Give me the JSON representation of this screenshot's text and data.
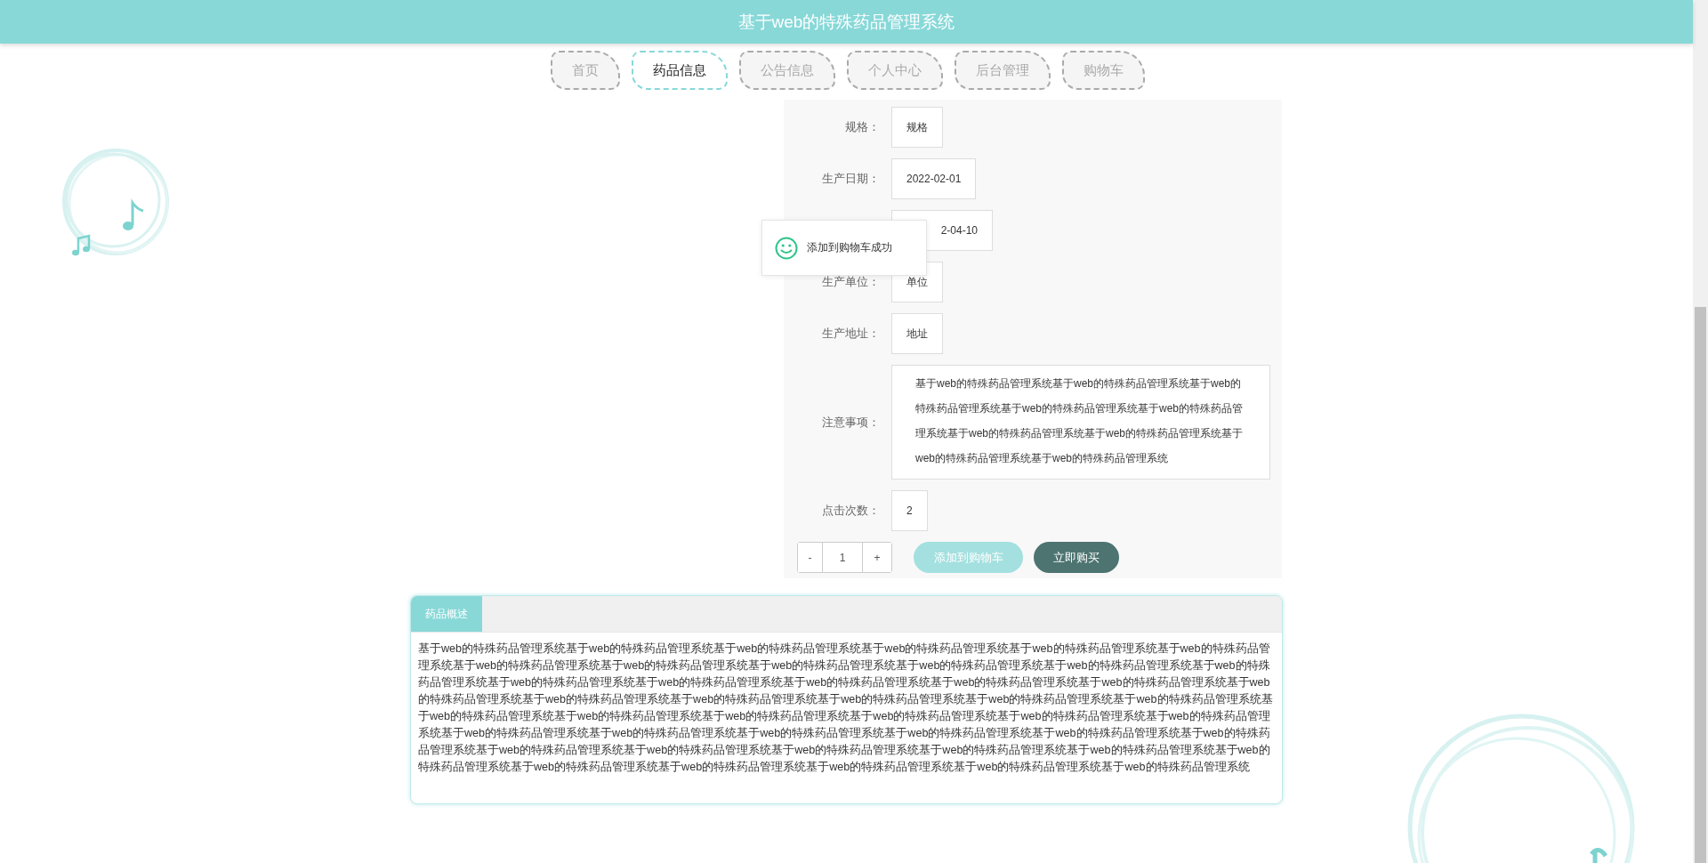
{
  "header": {
    "title": "基于web的特殊药品管理系统"
  },
  "nav": [
    {
      "label": "首页",
      "selected": false
    },
    {
      "label": "药品信息",
      "selected": true
    },
    {
      "label": "公告信息",
      "selected": false
    },
    {
      "label": "个人中心",
      "selected": false
    },
    {
      "label": "后台管理",
      "selected": false
    },
    {
      "label": "购物车",
      "selected": false
    }
  ],
  "details": [
    {
      "kind": "field",
      "label": "规格：",
      "value": "规格"
    },
    {
      "kind": "field",
      "label": "生产日期：",
      "value": "2022-02-01"
    },
    {
      "kind": "field",
      "value": "2-04-10"
    },
    {
      "kind": "field",
      "label": "生产单位：",
      "value": "单位"
    },
    {
      "kind": "field",
      "label": "生产地址：",
      "value": "地址"
    },
    {
      "kind": "notes",
      "label": "注意事项：",
      "value": "基于web的特殊药品管理系统基于web的特殊药品管理系统基于web的特殊药品管理系统基于web的特殊药品管理系统基于web的特殊药品管理系统基于web的特殊药品管理系统基于web的特殊药品管理系统基于web的特殊药品管理系统基于web的特殊药品管理系统"
    },
    {
      "kind": "field",
      "label": "点击次数：",
      "value": "2"
    }
  ],
  "toast": {
    "message": "添加到购物车成功"
  },
  "quantity": {
    "decrease": "-",
    "value": "1",
    "increase": "+"
  },
  "actions": [
    {
      "kind": "add",
      "label": "添加到购物车"
    },
    {
      "kind": "buy",
      "label": "立即购买"
    }
  ],
  "description": {
    "tab": "药品概述",
    "text": "基于web的特殊药品管理系统基于web的特殊药品管理系统基于web的特殊药品管理系统基于web的特殊药品管理系统基于web的特殊药品管理系统基于web的特殊药品管理系统基于web的特殊药品管理系统基于web的特殊药品管理系统基于web的特殊药品管理系统基于web的特殊药品管理系统基于web的特殊药品管理系统基于web的特殊药品管理系统基于web的特殊药品管理系统基于web的特殊药品管理系统基于web的特殊药品管理系统基于web的特殊药品管理系统基于web的特殊药品管理系统基于web的特殊药品管理系统基于web的特殊药品管理系统基于web的特殊药品管理系统基于web的特殊药品管理系统基于web的特殊药品管理系统基于web的特殊药品管理系统基于web的特殊药品管理系统基于web的特殊药品管理系统基于web的特殊药品管理系统基于web的特殊药品管理系统基于web的特殊药品管理系统基于web的特殊药品管理系统基于web的特殊药品管理系统基于web的特殊药品管理系统基于web的特殊药品管理系统基于web的特殊药品管理系统基于web的特殊药品管理系统基于web的特殊药品管理系统基于web的特殊药品管理系统基于web的特殊药品管理系统基于web的特殊药品管理系统基于web的特殊药品管理系统基于web的特殊药品管理系统基于web的特殊药品管理系统基于web的特殊药品管理系统基于web的特殊药品管理系统基于web的特殊药品管理系统基于web的特殊药品管理系统基于web的特殊药品管理系统"
  }
}
